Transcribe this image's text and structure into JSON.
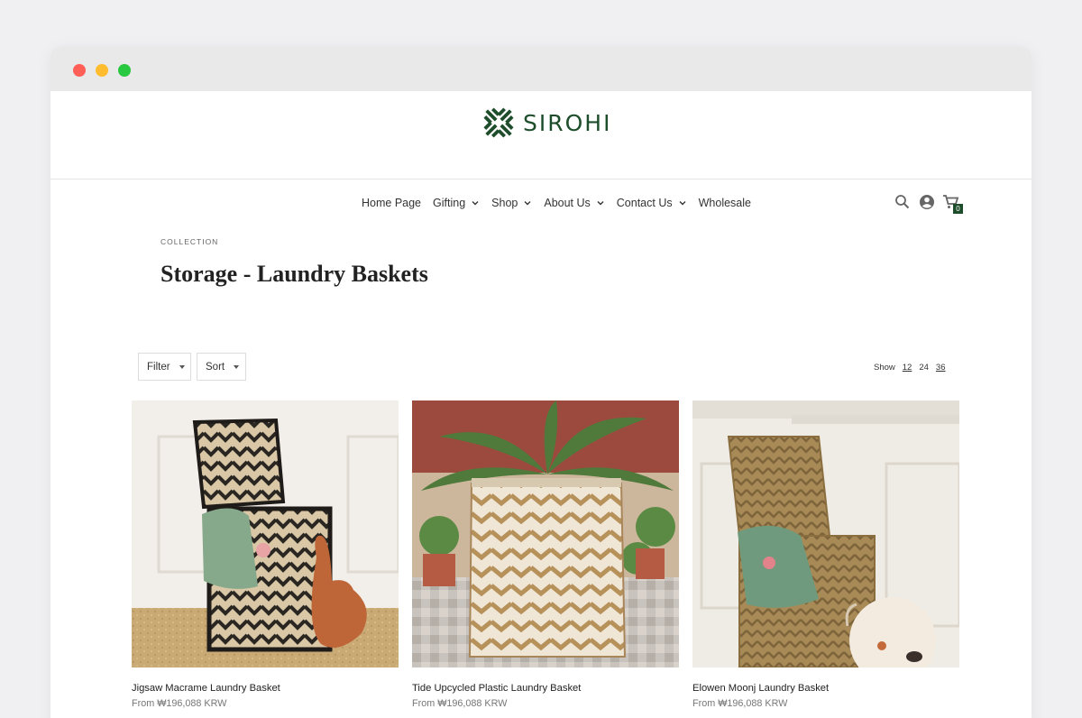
{
  "brand": {
    "name": "SIROHI",
    "color": "#1d4d2b",
    "logo_icon": "cross-weave-logo-icon"
  },
  "nav": {
    "items": [
      {
        "label": "Home Page",
        "has_dropdown": false
      },
      {
        "label": "Gifting",
        "has_dropdown": true
      },
      {
        "label": "Shop",
        "has_dropdown": true
      },
      {
        "label": "About Us",
        "has_dropdown": true
      },
      {
        "label": "Contact Us",
        "has_dropdown": true
      },
      {
        "label": "Wholesale",
        "has_dropdown": false
      }
    ]
  },
  "header_icons": {
    "search": "search-icon",
    "account": "account-icon",
    "cart": "cart-icon",
    "cart_count": "0"
  },
  "collection": {
    "eyebrow": "COLLECTION",
    "title": "Storage - Laundry Baskets"
  },
  "toolbar": {
    "filter_label": "Filter",
    "sort_label": "Sort",
    "show_label": "Show",
    "show_options": [
      "12",
      "24",
      "36"
    ],
    "show_selected": "24"
  },
  "products": [
    {
      "name": "Jigsaw Macrame Laundry Basket",
      "price": "From ₩196,088 KRW"
    },
    {
      "name": "Tide Upcycled Plastic Laundry Basket",
      "price": "From ₩196,088 KRW"
    },
    {
      "name": "Elowen Moonj Laundry Basket",
      "price": "From ₩196,088 KRW"
    }
  ]
}
